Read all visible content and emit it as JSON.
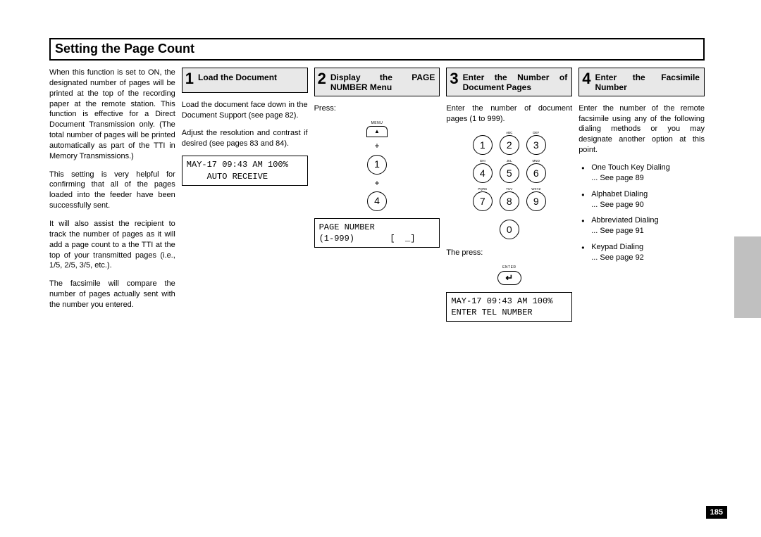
{
  "title": "Setting the Page Count",
  "page_number": "185",
  "intro": {
    "p1": "When this function is set to ON, the designated number of pages will be printed at the top of the recording paper at the remote station. This function is effective for a Direct Document Transmission only. (The total number of pages will be printed automatically as part of the TTI in Memory Transmissions.)",
    "p2": "This setting is very helpful for confirming that all of the pages loaded into the feeder have been successfully sent.",
    "p3": "It will also assist the recipient to track the number of pages as it will add a page count to a the TTI at the top of your transmitted pages (i.e., 1/5, 2/5, 3/5, etc.).",
    "p4": "The facsimile will compare the number of pages actually sent with the number you entered."
  },
  "steps": {
    "s1": {
      "num": "1",
      "title": "Load the Document",
      "p1": "Load the document face down in the Document Support (see page 82).",
      "p2": "Adjust the resolution and contrast if desired (see pages 83 and 84).",
      "lcd": "MAY-17 09:43 AM 100%\n    AUTO RECEIVE"
    },
    "s2": {
      "num": "2",
      "title": "Display the PAGE NUMBER Menu",
      "press_label": "Press:",
      "menu_label": "MENU",
      "menu_arrow": "▲",
      "plus": "+",
      "key1": "1",
      "key4": "4",
      "lcd": "PAGE NUMBER\n(1-999)       [  _]"
    },
    "s3": {
      "num": "3",
      "title": "Enter the Number of Document Pages",
      "p1": "Enter the number of document pages (1 to 999).",
      "keypad": {
        "labels": [
          "",
          "ABC",
          "DEF",
          "GHI",
          "JKL",
          "MNO",
          "PQRS",
          "TUV",
          "WXYZ"
        ],
        "keys": [
          "1",
          "2",
          "3",
          "4",
          "5",
          "6",
          "7",
          "8",
          "9",
          "0"
        ]
      },
      "then_press": "The press:",
      "enter_label": "ENTER",
      "enter_symbol": "↵",
      "lcd": "MAY-17 09:43 AM 100%\nENTER TEL NUMBER"
    },
    "s4": {
      "num": "4",
      "title": "Enter the Facsimile Number",
      "p1": "Enter the number of the remote facsimile using any of the following dialing methods or you may designate another option at this point.",
      "bullets": [
        {
          "a": "One Touch Key Dialing",
          "b": "... See page 89"
        },
        {
          "a": "Alphabet Dialing",
          "b": "... See page 90"
        },
        {
          "a": "Abbreviated Dialing",
          "b": "... See page 91"
        },
        {
          "a": "Keypad Dialing",
          "b": "... See page 92"
        }
      ]
    }
  }
}
